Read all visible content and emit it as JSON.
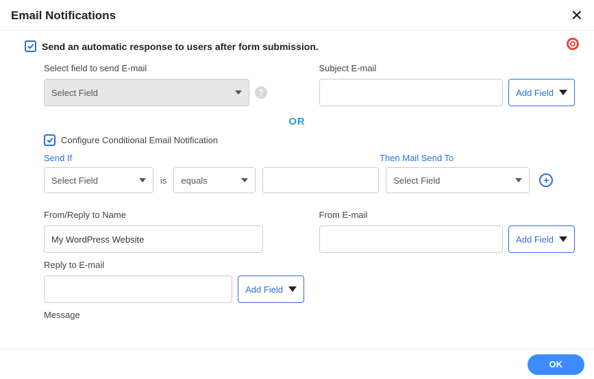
{
  "dialog": {
    "title": "Email Notifications",
    "ok": "OK"
  },
  "main_checkbox": {
    "label": "Send an automatic response to users after form submission.",
    "checked": true
  },
  "select_field": {
    "label": "Select field to send E-mail",
    "value": "Select Field"
  },
  "subject": {
    "label": "Subject E-mail",
    "value": "",
    "add_field": "Add Field"
  },
  "or_text": "OR",
  "conditional_checkbox": {
    "label": "Configure Conditional Email Notification",
    "checked": true
  },
  "condition": {
    "send_if_label": "Send If",
    "field_value": "Select Field",
    "is_word": "is",
    "operator": "equals",
    "text_value": "",
    "then_label": "Then Mail Send To",
    "then_value": "Select Field"
  },
  "from_name": {
    "label": "From/Reply to Name",
    "value": "My WordPress Website"
  },
  "from_email": {
    "label": "From E-mail",
    "value": "",
    "add_field": "Add Field"
  },
  "reply_to": {
    "label": "Reply to E-mail",
    "value": "",
    "add_field": "Add Field"
  },
  "message": {
    "label": "Message"
  }
}
